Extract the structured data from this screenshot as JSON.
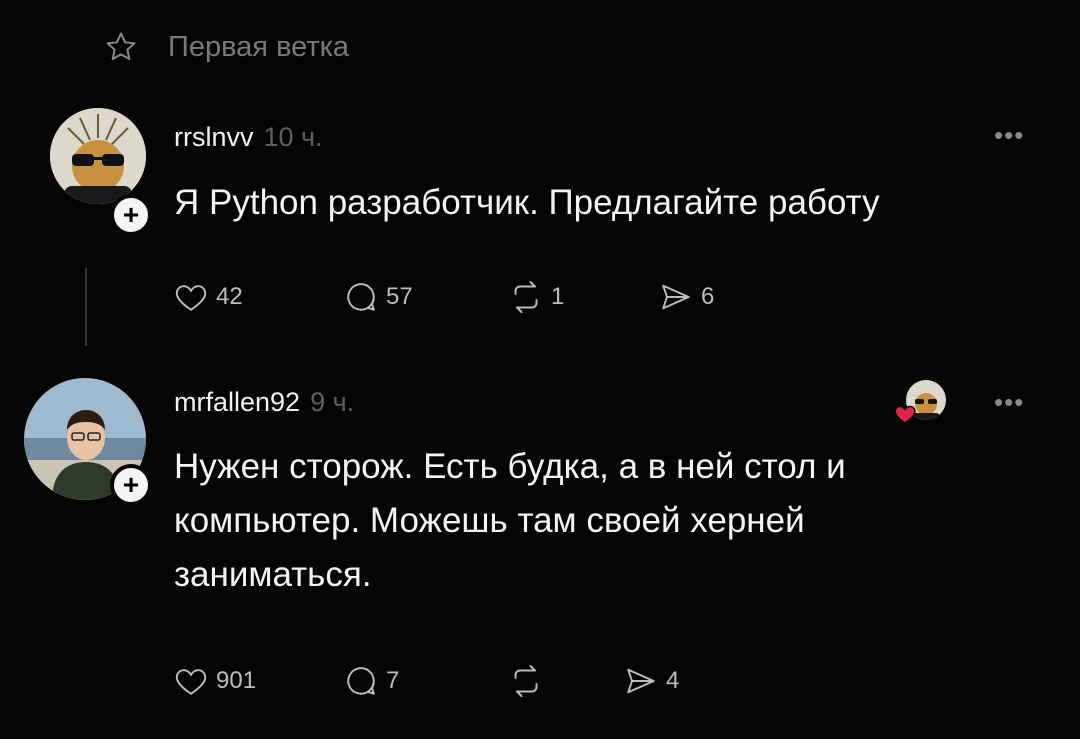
{
  "thread": {
    "title": "Первая ветка",
    "icon": "star-icon"
  },
  "posts": [
    {
      "username": "rrslnvv",
      "timestamp": "10 ч.",
      "text": "Я Python разработчик. Предлагайте работу",
      "likes": "42",
      "replies": "57",
      "reposts": "1",
      "shares": "6"
    },
    {
      "username": "mrfallen92",
      "timestamp": "9 ч.",
      "text_lines": [
        "Нужен сторож. Есть будка, а в ней стол и",
        "компьютер. Можешь там своей херней",
        "заниматься."
      ],
      "likes": "901",
      "replies": "7",
      "reposts": "",
      "shares": "4"
    }
  ],
  "colors": {
    "background": "#050505",
    "muted": "#7a7a7a",
    "liked_heart": "#e0244a"
  }
}
